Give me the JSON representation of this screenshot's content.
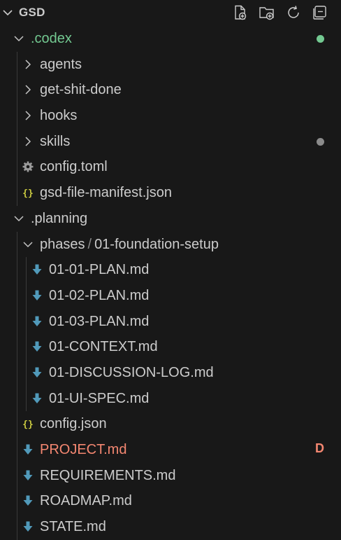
{
  "header": {
    "title": "GSD",
    "actions": [
      "new-file-icon",
      "new-folder-icon",
      "refresh-icon",
      "collapse-all-icon"
    ]
  },
  "colors": {
    "background": "#181818",
    "text": "#cccccc",
    "untracked": "#73c991",
    "deleted": "#f48771",
    "markdown_icon": "#519aba",
    "json_icon": "#cbcb41",
    "muted_dot": "#8b8b8b"
  },
  "rows": [
    {
      "type": "folder",
      "open": true,
      "label": ".codex",
      "label2": "",
      "depth": 1,
      "status": "untracked",
      "icon": "chevron-down-icon",
      "badge": "",
      "dot": "#73c991"
    },
    {
      "type": "folder",
      "open": false,
      "label": "agents",
      "label2": "",
      "depth": 2,
      "status": "",
      "icon": "chevron-right-icon",
      "badge": "",
      "dot": ""
    },
    {
      "type": "folder",
      "open": false,
      "label": "get-shit-done",
      "label2": "",
      "depth": 2,
      "status": "",
      "icon": "chevron-right-icon",
      "badge": "",
      "dot": ""
    },
    {
      "type": "folder",
      "open": false,
      "label": "hooks",
      "label2": "",
      "depth": 2,
      "status": "",
      "icon": "chevron-right-icon",
      "badge": "",
      "dot": ""
    },
    {
      "type": "folder",
      "open": false,
      "label": "skills",
      "label2": "",
      "depth": 2,
      "status": "",
      "icon": "chevron-right-icon",
      "badge": "",
      "dot": "#8b8b8b"
    },
    {
      "type": "file",
      "label": "config.toml",
      "label2": "",
      "depth": 2,
      "status": "",
      "icon": "gear-icon",
      "badge": "",
      "dot": ""
    },
    {
      "type": "file",
      "label": "gsd-file-manifest.json",
      "label2": "",
      "depth": 2,
      "status": "",
      "icon": "json-braces-icon",
      "badge": "",
      "dot": ""
    },
    {
      "type": "folder",
      "open": true,
      "label": ".planning",
      "label2": "",
      "depth": 1,
      "status": "",
      "icon": "chevron-down-icon",
      "badge": "",
      "dot": ""
    },
    {
      "type": "folder",
      "open": true,
      "label": "phases",
      "label2": "01-foundation-setup",
      "depth": 2,
      "status": "",
      "icon": "chevron-down-icon",
      "badge": "",
      "dot": ""
    },
    {
      "type": "file",
      "label": "01-01-PLAN.md",
      "label2": "",
      "depth": 3,
      "status": "",
      "icon": "markdown-arrow-icon",
      "badge": "",
      "dot": ""
    },
    {
      "type": "file",
      "label": "01-02-PLAN.md",
      "label2": "",
      "depth": 3,
      "status": "",
      "icon": "markdown-arrow-icon",
      "badge": "",
      "dot": ""
    },
    {
      "type": "file",
      "label": "01-03-PLAN.md",
      "label2": "",
      "depth": 3,
      "status": "",
      "icon": "markdown-arrow-icon",
      "badge": "",
      "dot": ""
    },
    {
      "type": "file",
      "label": "01-CONTEXT.md",
      "label2": "",
      "depth": 3,
      "status": "",
      "icon": "markdown-arrow-icon",
      "badge": "",
      "dot": ""
    },
    {
      "type": "file",
      "label": "01-DISCUSSION-LOG.md",
      "label2": "",
      "depth": 3,
      "status": "",
      "icon": "markdown-arrow-icon",
      "badge": "",
      "dot": ""
    },
    {
      "type": "file",
      "label": "01-UI-SPEC.md",
      "label2": "",
      "depth": 3,
      "status": "",
      "icon": "markdown-arrow-icon",
      "badge": "",
      "dot": ""
    },
    {
      "type": "file",
      "label": "config.json",
      "label2": "",
      "depth": 2,
      "status": "",
      "icon": "json-braces-icon",
      "badge": "",
      "dot": ""
    },
    {
      "type": "file",
      "label": "PROJECT.md",
      "label2": "",
      "depth": 2,
      "status": "deleted",
      "icon": "markdown-arrow-icon",
      "badge": "D",
      "dot": ""
    },
    {
      "type": "file",
      "label": "REQUIREMENTS.md",
      "label2": "",
      "depth": 2,
      "status": "",
      "icon": "markdown-arrow-icon",
      "badge": "",
      "dot": ""
    },
    {
      "type": "file",
      "label": "ROADMAP.md",
      "label2": "",
      "depth": 2,
      "status": "",
      "icon": "markdown-arrow-icon",
      "badge": "",
      "dot": ""
    },
    {
      "type": "file",
      "label": "STATE.md",
      "label2": "",
      "depth": 2,
      "status": "",
      "icon": "markdown-arrow-icon",
      "badge": "",
      "dot": ""
    }
  ]
}
